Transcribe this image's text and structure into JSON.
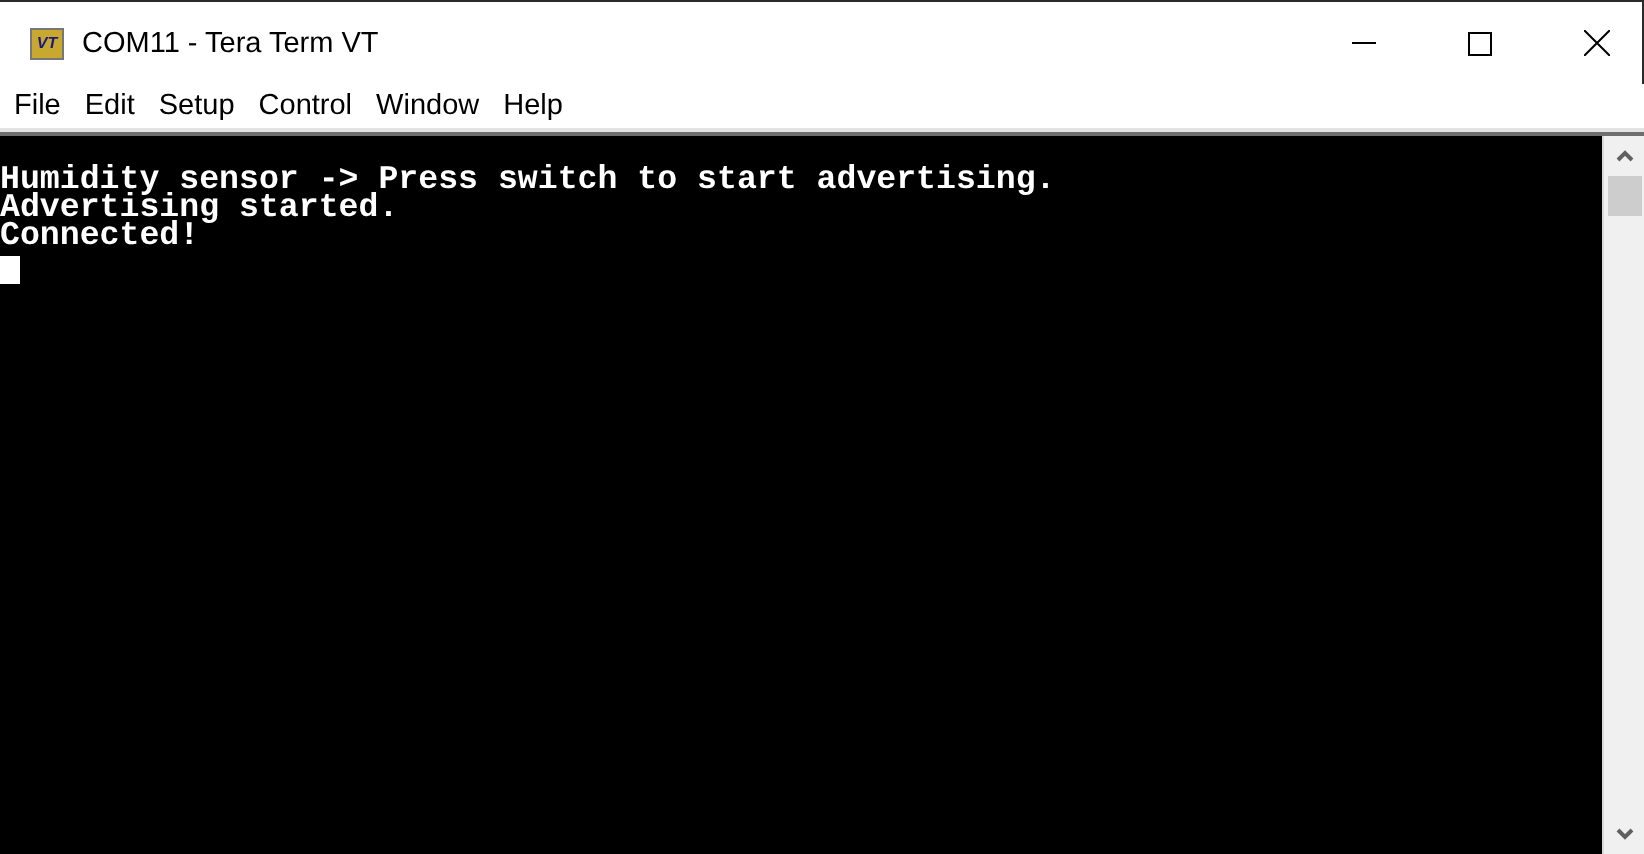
{
  "window": {
    "title": "COM11 - Tera Term VT",
    "app_icon_text": "VT"
  },
  "menu": [
    "File",
    "Edit",
    "Setup",
    "Control",
    "Window",
    "Help"
  ],
  "terminal": {
    "lines": [
      "Humidity sensor -> Press switch to start advertising.",
      "Advertising started.",
      "Connected!"
    ],
    "cursor": true
  }
}
